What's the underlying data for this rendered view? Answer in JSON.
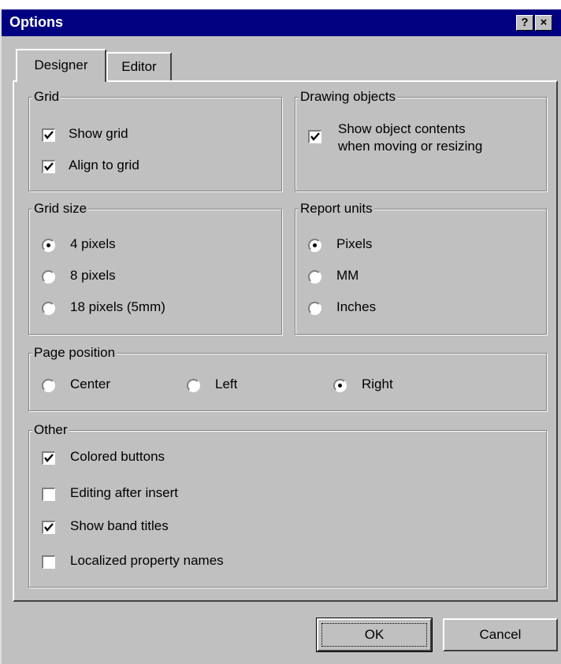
{
  "window": {
    "title": "Options",
    "help_glyph": "?",
    "close_glyph": "×"
  },
  "tabs": [
    {
      "label": "Designer",
      "active": true
    },
    {
      "label": "Editor",
      "active": false
    }
  ],
  "grid": {
    "legend": "Grid",
    "show_grid": {
      "label": "Show grid",
      "checked": true
    },
    "align_to_grid": {
      "label": "Align to grid",
      "checked": true
    }
  },
  "drawing": {
    "legend": "Drawing objects",
    "show_contents": {
      "line1": "Show object contents",
      "line2": "when moving or resizing",
      "checked": true
    }
  },
  "grid_size": {
    "legend": "Grid size",
    "options": [
      {
        "label": "4 pixels",
        "selected": true
      },
      {
        "label": "8 pixels",
        "selected": false
      },
      {
        "label": "18 pixels (5mm)",
        "selected": false
      }
    ]
  },
  "report_units": {
    "legend": "Report units",
    "options": [
      {
        "label": "Pixels",
        "selected": true
      },
      {
        "label": "MM",
        "selected": false
      },
      {
        "label": "Inches",
        "selected": false
      }
    ]
  },
  "page_position": {
    "legend": "Page position",
    "options": [
      {
        "label": "Center",
        "selected": false
      },
      {
        "label": "Left",
        "selected": false
      },
      {
        "label": "Right",
        "selected": true
      }
    ]
  },
  "other": {
    "legend": "Other",
    "items": [
      {
        "label": "Colored buttons",
        "checked": true
      },
      {
        "label": "Editing after insert",
        "checked": false
      },
      {
        "label": "Show band titles",
        "checked": true
      },
      {
        "label": "Localized property names",
        "checked": false
      }
    ]
  },
  "buttons": {
    "ok": "OK",
    "cancel": "Cancel"
  }
}
